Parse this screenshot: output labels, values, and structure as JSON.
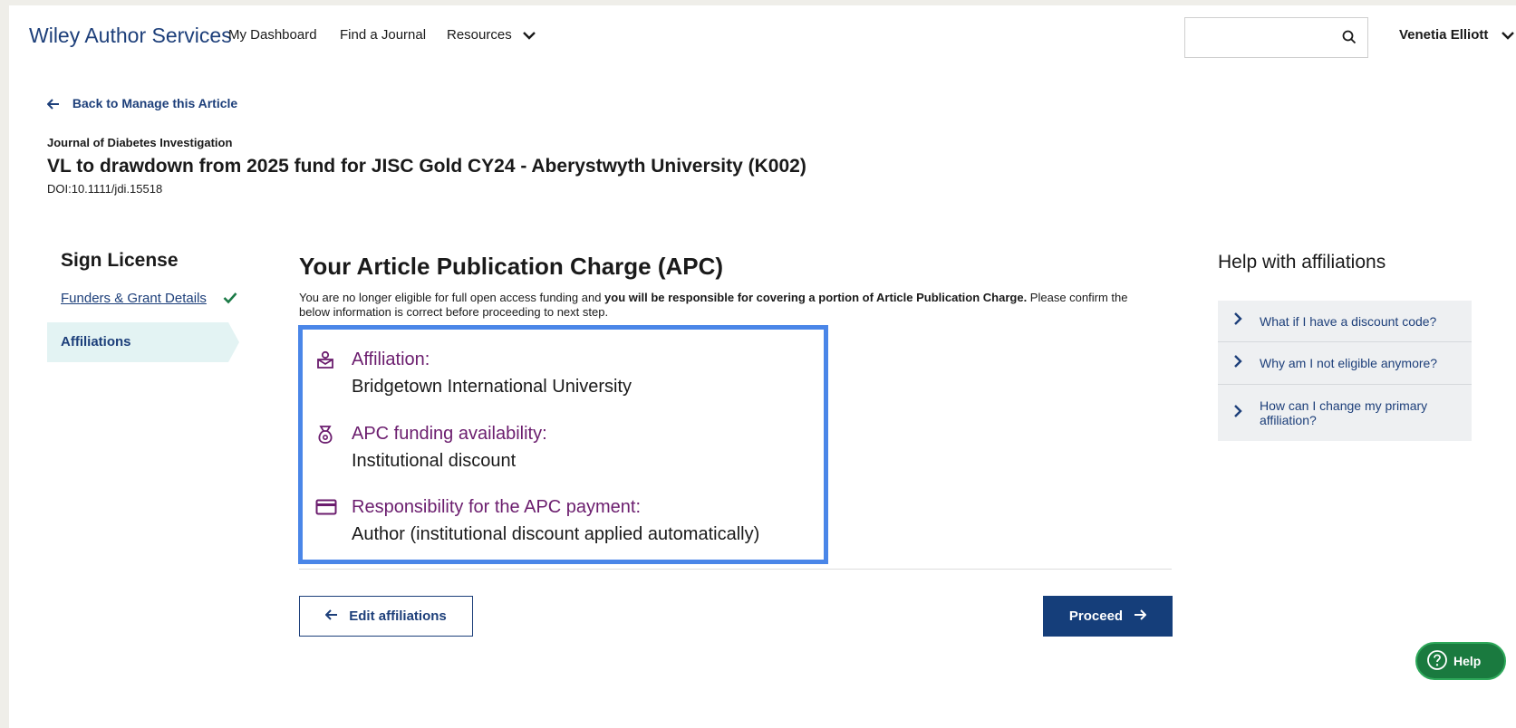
{
  "header": {
    "brand": "Wiley Author Services",
    "nav": [
      "My Dashboard",
      "Find a Journal",
      "Resources"
    ],
    "search_placeholder": "",
    "user_name": "Venetia Elliott"
  },
  "article": {
    "back_link": "Back to Manage this Article",
    "journal": "Journal of Diabetes Investigation",
    "title": "VL to drawdown from 2025 fund for JISC Gold CY24 - Aberystwyth University (K002)",
    "doi": "DOI:10.1111/jdi.15518"
  },
  "steps": {
    "title": "Sign License",
    "items": [
      {
        "label": "Funders & Grant Details",
        "status": "complete"
      },
      {
        "label": "Affiliations",
        "status": "active"
      }
    ]
  },
  "main": {
    "title": "Your Article Publication Charge (APC)",
    "intro_before": "You are no longer eligible for full open access funding and ",
    "intro_bold": "you will be responsible for covering a portion of Article Publication Charge.",
    "intro_after": " Please confirm the below information is correct before proceeding to next step.",
    "info": [
      {
        "icon": "affiliation-icon",
        "label": "Affiliation:",
        "value": "Bridgetown International University"
      },
      {
        "icon": "money-bag-icon",
        "label": "APC funding availability:",
        "value": "Institutional discount"
      },
      {
        "icon": "credit-card-icon",
        "label": "Responsibility for the APC payment:",
        "value": "Author (institutional discount applied automatically)"
      }
    ],
    "edit_button": "Edit affiliations",
    "proceed_button": "Proceed"
  },
  "help": {
    "title": "Help with affiliations",
    "items": [
      "What if I have a discount code?",
      "Why am I not eligible anymore?",
      "How can I change my primary affiliation?"
    ],
    "fab_label": "Help"
  },
  "colors": {
    "brand_blue": "#1d3f7a",
    "accent_purple": "#6b1d6e",
    "highlight_border": "#4a86e8",
    "active_step_bg": "#e3f3f3",
    "help_green": "#1a7a3f"
  }
}
